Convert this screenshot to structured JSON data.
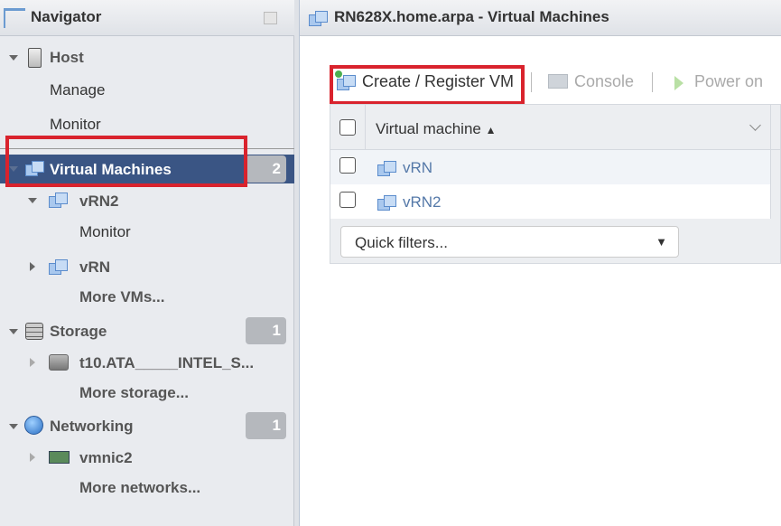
{
  "navigator": {
    "title": "Navigator",
    "host": {
      "label": "Host",
      "children": [
        "Manage",
        "Monitor"
      ]
    },
    "vms": {
      "label": "Virtual Machines",
      "count": "2",
      "items": [
        {
          "name": "vRN2",
          "children": [
            "Monitor"
          ]
        },
        {
          "name": "vRN"
        }
      ],
      "more": "More VMs..."
    },
    "storage": {
      "label": "Storage",
      "count": "1",
      "items": [
        "t10.ATA_____INTEL_S..."
      ],
      "more": "More storage..."
    },
    "networking": {
      "label": "Networking",
      "count": "1",
      "items": [
        "vmnic2"
      ],
      "more": "More networks..."
    }
  },
  "main": {
    "title": "RN628X.home.arpa - Virtual Machines",
    "toolbar": {
      "create": "Create / Register VM",
      "console": "Console",
      "power_on": "Power on"
    },
    "table": {
      "column": "Virtual machine",
      "sort": "▲",
      "rows": [
        "vRN",
        "vRN2"
      ]
    },
    "quick_filters": "Quick filters...",
    "dropdown_arrow": "▼"
  },
  "colors": {
    "selected": "#3a5584",
    "highlight": "#d9232d",
    "link": "#5478a8"
  }
}
